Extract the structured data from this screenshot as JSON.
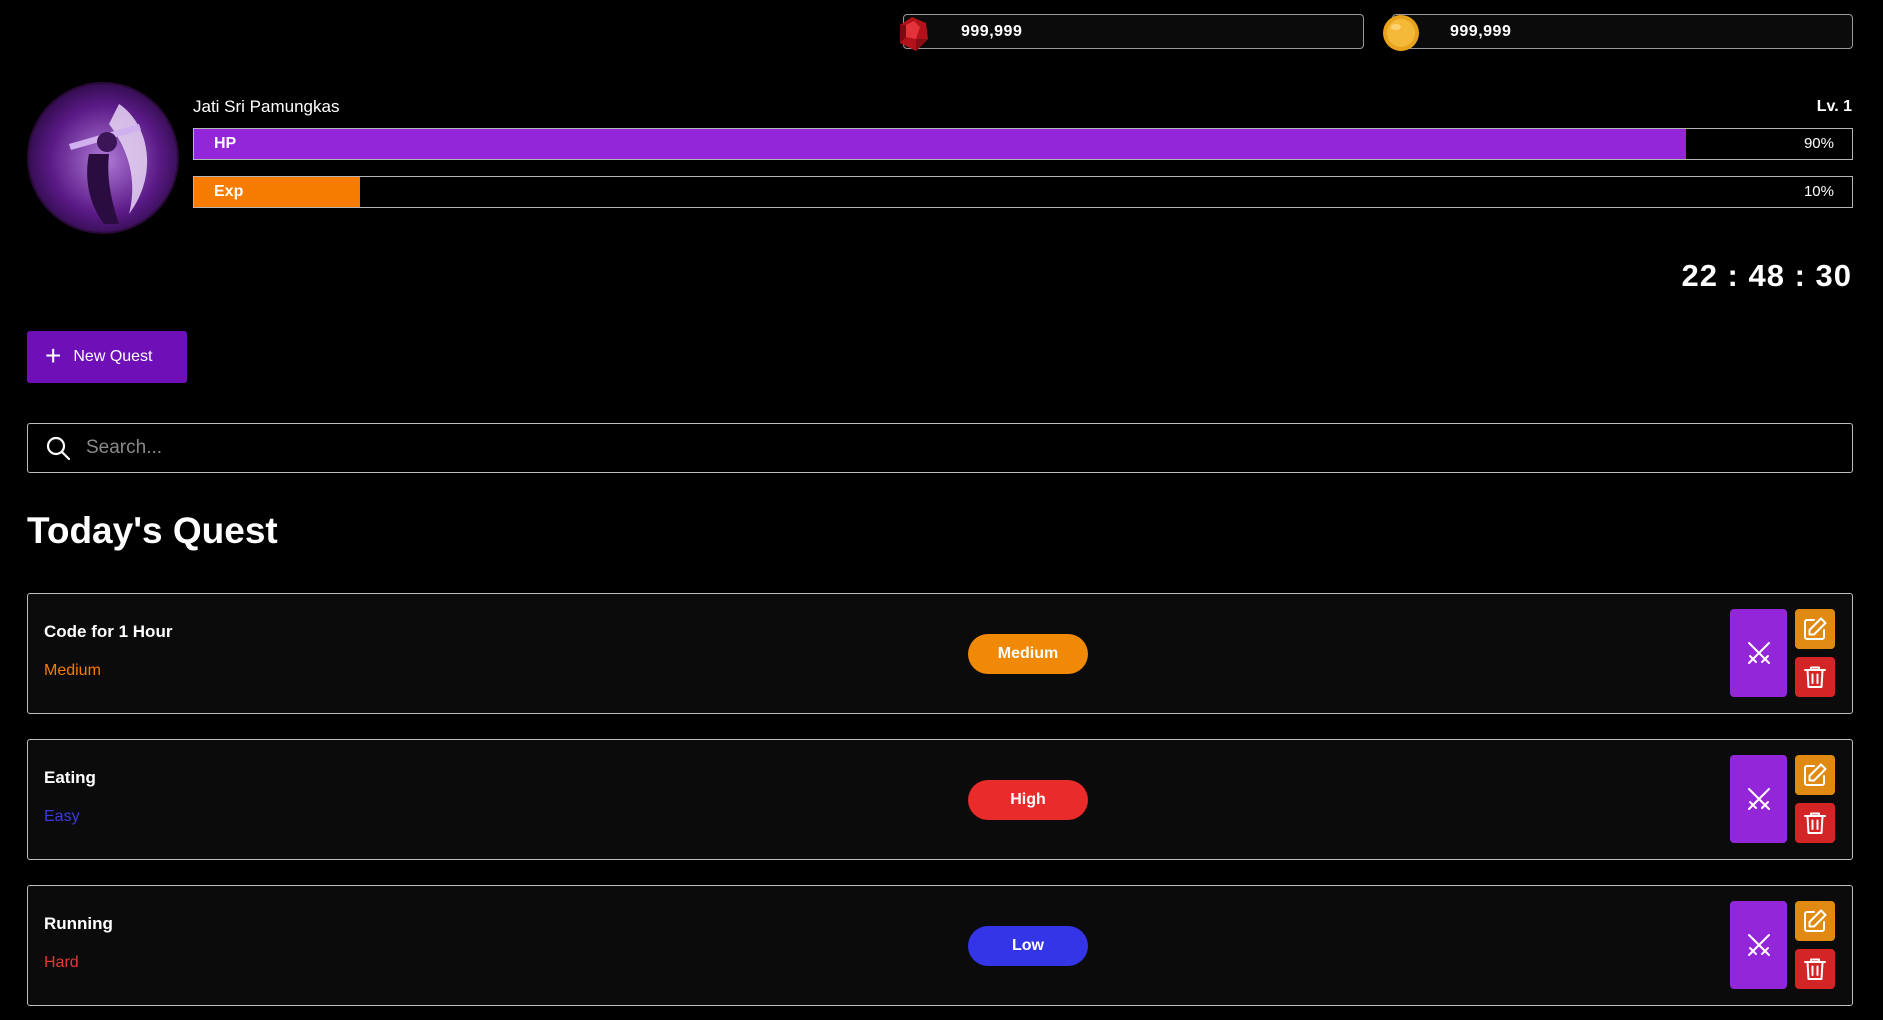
{
  "currency": {
    "gems": "999,999",
    "coins": "999,999"
  },
  "player": {
    "name": "Jati Sri Pamungkas",
    "level": "Lv. 1",
    "hp": {
      "label": "HP",
      "percent_text": "90%",
      "percent": 90
    },
    "exp": {
      "label": "Exp",
      "percent_text": "10%",
      "percent": 10
    }
  },
  "clock": "22 : 48 : 30",
  "actions": {
    "new_quest_label": "New Quest"
  },
  "search": {
    "placeholder": "Search...",
    "value": ""
  },
  "section_title": "Today's Quest",
  "quests": [
    {
      "name": "Code for 1 Hour",
      "difficulty": "Medium",
      "difficulty_color": "#f57c00",
      "priority": "Medium",
      "priority_color": "#f08a06"
    },
    {
      "name": "Eating",
      "difficulty": "Easy",
      "difficulty_color": "#3b3bdc",
      "priority": "High",
      "priority_color": "#ea2b2b"
    },
    {
      "name": "Running",
      "difficulty": "Hard",
      "difficulty_color": "#e53935",
      "priority": "Low",
      "priority_color": "#3535e8"
    }
  ],
  "icons": {
    "gem": "ruby-icon",
    "coin": "coin-icon",
    "add": "plus-icon",
    "search": "search-icon",
    "attack": "crossed-swords-icon",
    "edit": "edit-icon",
    "delete": "trash-icon"
  }
}
